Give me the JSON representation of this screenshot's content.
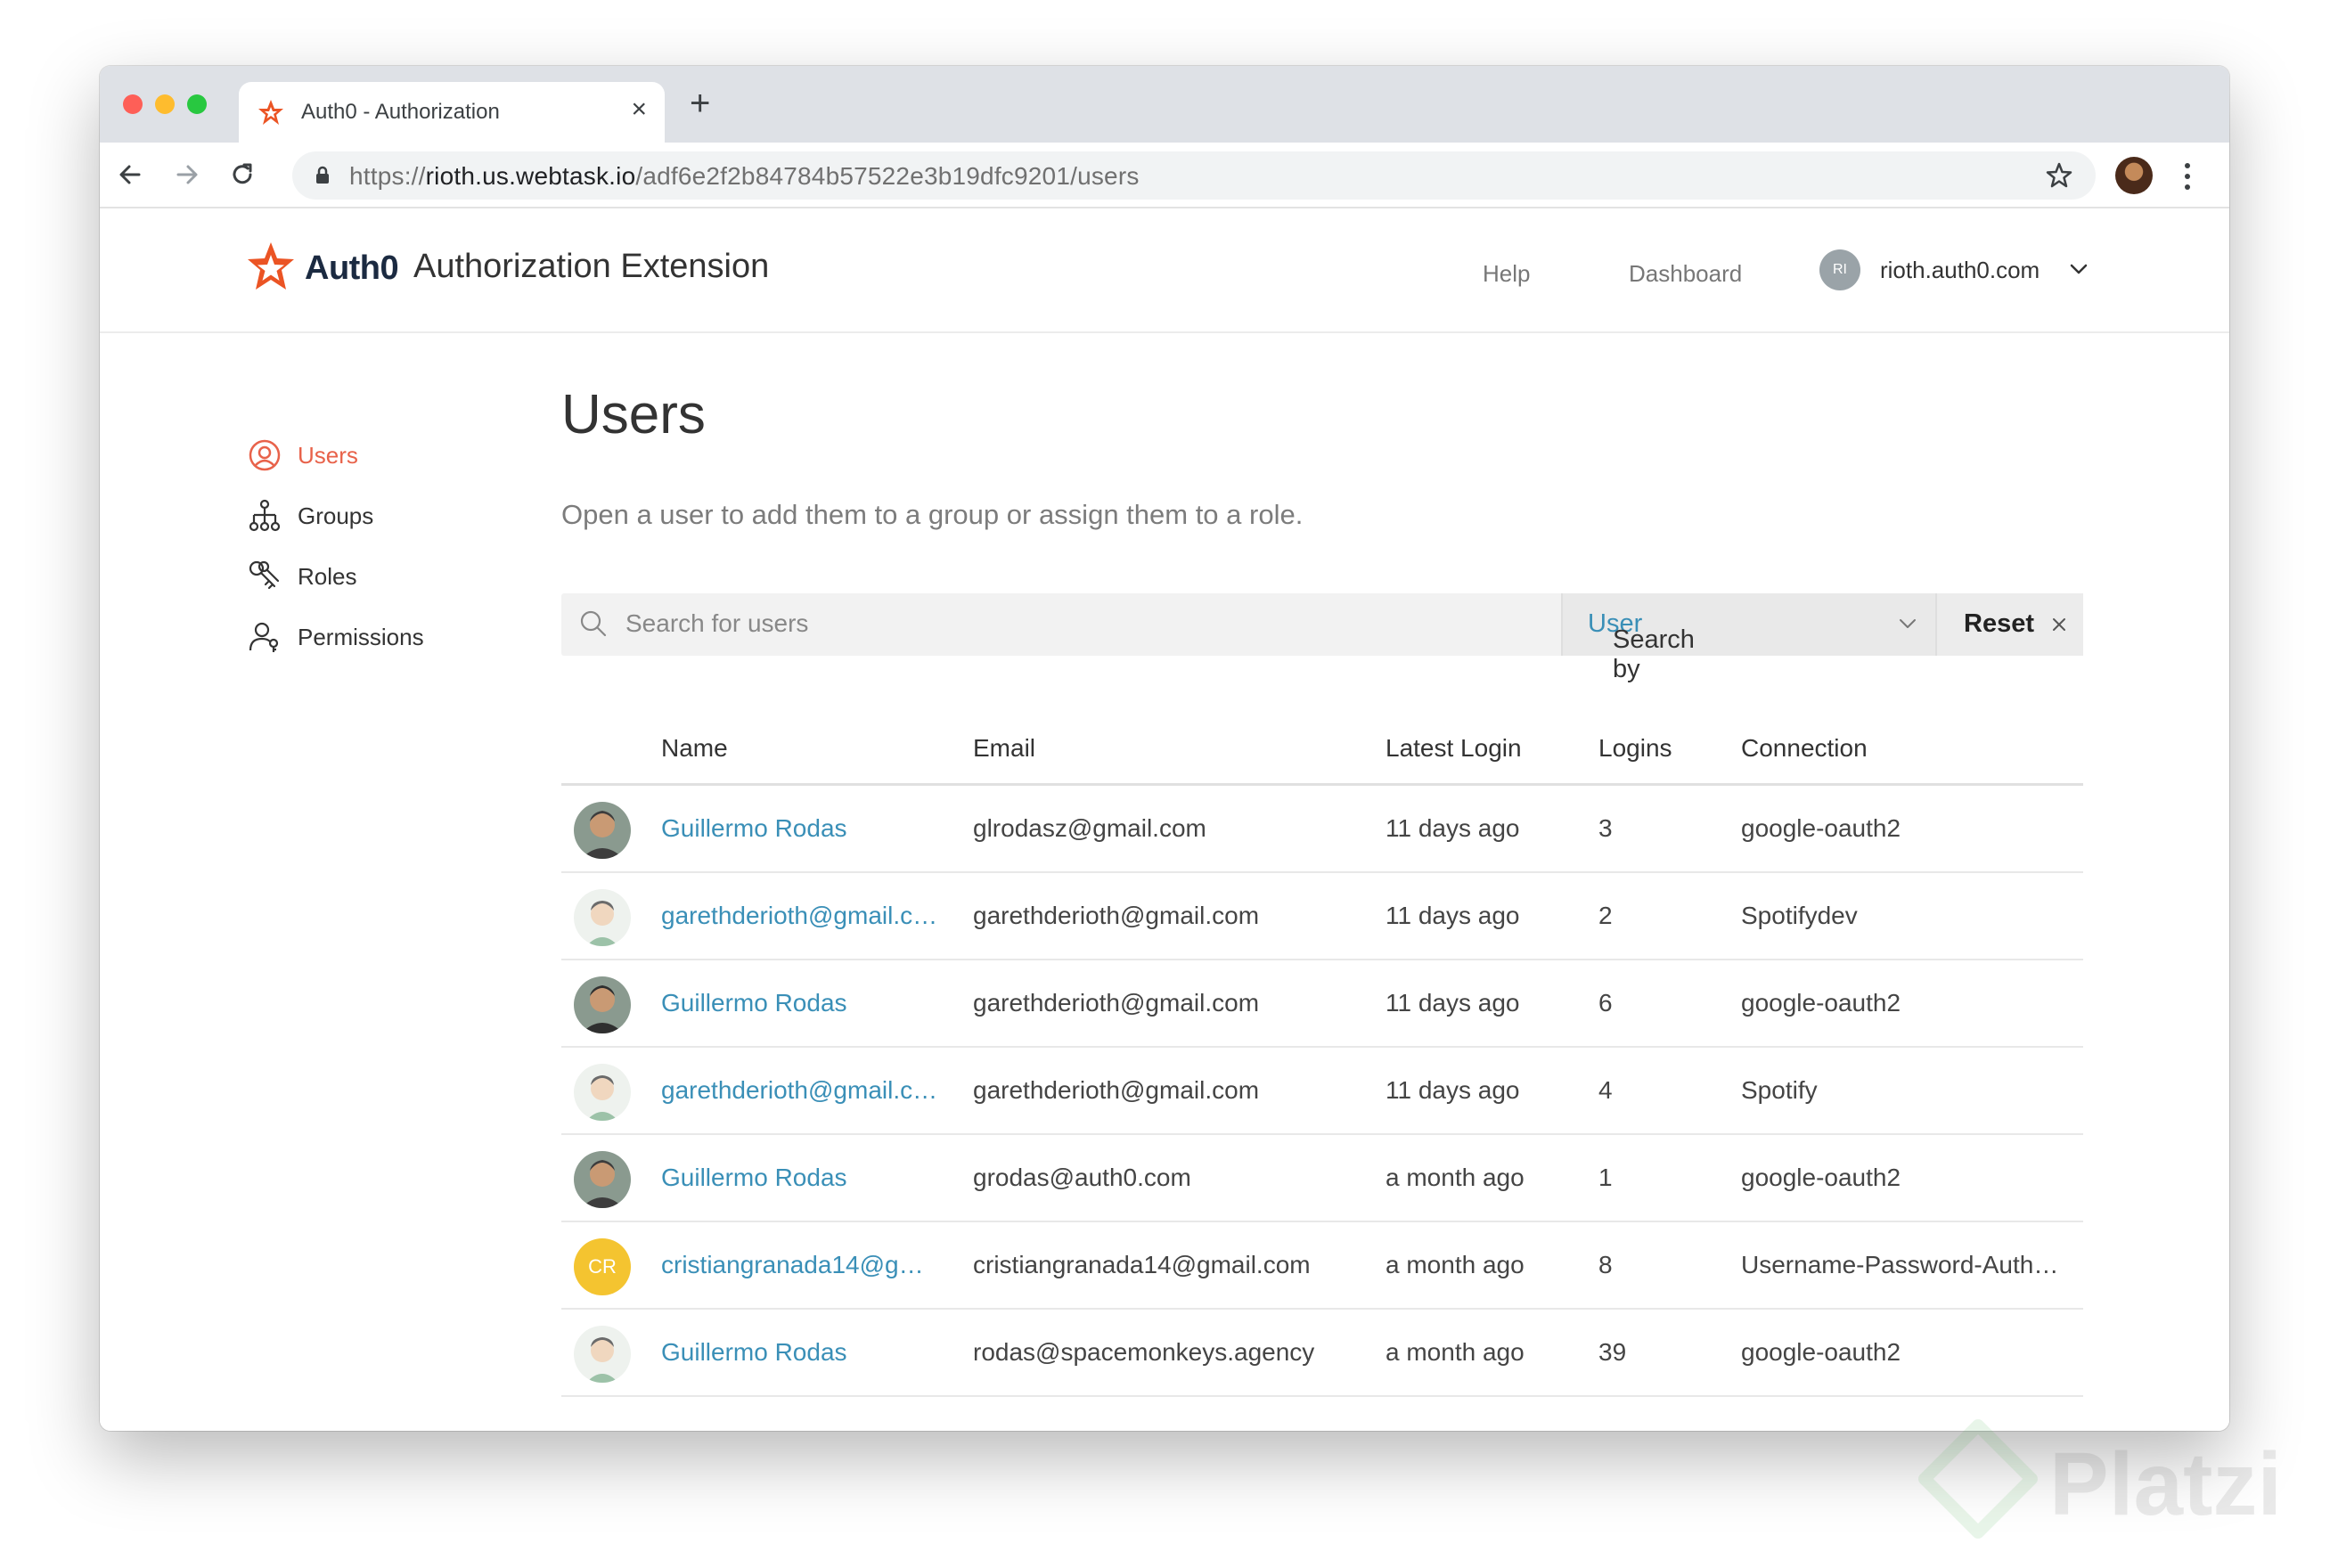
{
  "browser": {
    "tab_title": "Auth0 - Authorization",
    "url_protocol": "https://",
    "url_host": "rioth.us.webtask.io",
    "url_path": "/adf6e2f2b84784b57522e3b19dfc9201/users"
  },
  "header": {
    "logo_text": "Auth0",
    "app_title": "Authorization Extension",
    "help_label": "Help",
    "dashboard_label": "Dashboard",
    "avatar_initials": "RI",
    "tenant": "rioth.auth0.com"
  },
  "sidebar": {
    "items": [
      {
        "label": "Users"
      },
      {
        "label": "Groups"
      },
      {
        "label": "Roles"
      },
      {
        "label": "Permissions"
      }
    ]
  },
  "main": {
    "title": "Users",
    "subtitle": "Open a user to add them to a group or assign them to a role.",
    "search_placeholder": "Search for users",
    "search_by_prefix": "Search by",
    "search_by_value": "User",
    "reset_label": "Reset"
  },
  "table": {
    "columns": [
      "Name",
      "Email",
      "Latest Login",
      "Logins",
      "Connection"
    ],
    "rows": [
      {
        "name": "Guillermo Rodas",
        "email": "glrodasz@gmail.com",
        "latest_login": "11 days ago",
        "logins": "3",
        "connection": "google-oauth2",
        "avatar": "photo"
      },
      {
        "name": "garethderioth@gmail.c…",
        "email": "garethderioth@gmail.com",
        "latest_login": "11 days ago",
        "logins": "2",
        "connection": "Spotifydev",
        "avatar": "cartoon"
      },
      {
        "name": "Guillermo Rodas",
        "email": "garethderioth@gmail.com",
        "latest_login": "11 days ago",
        "logins": "6",
        "connection": "google-oauth2",
        "avatar": "photo"
      },
      {
        "name": "garethderioth@gmail.c…",
        "email": "garethderioth@gmail.com",
        "latest_login": "11 days ago",
        "logins": "4",
        "connection": "Spotify",
        "avatar": "cartoon"
      },
      {
        "name": "Guillermo Rodas",
        "email": "grodas@auth0.com",
        "latest_login": "a month ago",
        "logins": "1",
        "connection": "google-oauth2",
        "avatar": "photo"
      },
      {
        "name": "cristiangranada14@g…",
        "email": "cristiangranada14@gmail.com",
        "latest_login": "a month ago",
        "logins": "8",
        "connection": "Username-Password-Auth…",
        "avatar": "initials",
        "initials": "CR"
      },
      {
        "name": "Guillermo Rodas",
        "email": "rodas@spacemonkeys.agency",
        "latest_login": "a month ago",
        "logins": "39",
        "connection": "google-oauth2",
        "avatar": "cartoon"
      }
    ]
  },
  "colors": {
    "accent": "#3a8fb7",
    "brand": "#eb5424",
    "active_nav": "#e8624a",
    "initials_avatar": "#f4c430"
  },
  "watermark": "Platzi"
}
